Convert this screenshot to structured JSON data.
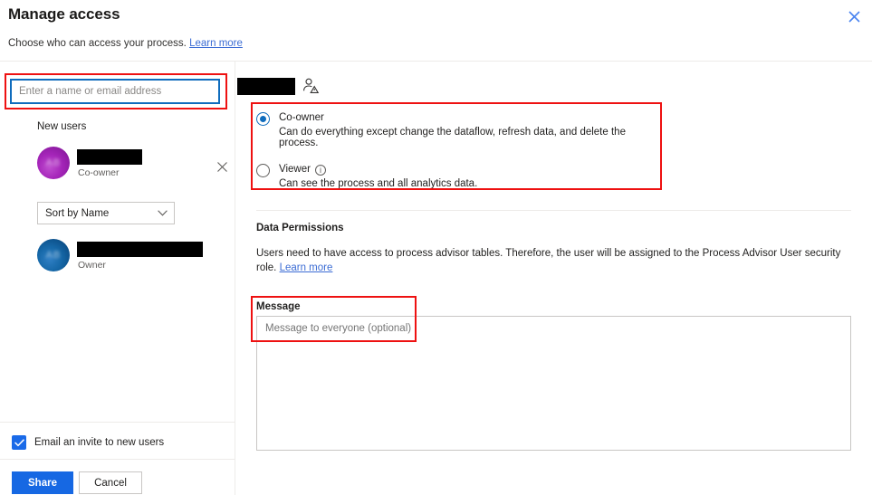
{
  "dialog": {
    "title": "Manage access",
    "subtitle": "Choose who can access your process.",
    "subtitle_link": "Learn more",
    "close_icon": "close-icon"
  },
  "left_panel": {
    "people_input": {
      "placeholder": "Enter a name or email address",
      "value": ""
    },
    "new_users_label": "New users",
    "users": [
      {
        "name": "",
        "role": "Co-owner",
        "avatar_color": "#a626ba",
        "avatar_initials": "AB",
        "removable": true,
        "redacted": true,
        "redact_width": 72
      },
      {
        "name": "",
        "role": "Owner",
        "avatar_color": "#1668a8",
        "avatar_initials": "AB",
        "removable": false,
        "redacted": true,
        "redact_width": 139
      }
    ],
    "sort": {
      "selected": "Sort by Name",
      "options": [
        "Sort by Name"
      ],
      "chevron_icon": "chevron-down-icon"
    },
    "email_invite": {
      "label": "Email an invite to new users",
      "checked": true
    },
    "share_button": "Share",
    "cancel_button": "Cancel"
  },
  "right_panel": {
    "selected_user_name": "",
    "selected_user_icon": "person-warning-icon",
    "roles": [
      {
        "label": "Co-owner",
        "description": "Can do everything except change the dataflow, refresh data, and delete the process.",
        "selected": true,
        "has_info": false
      },
      {
        "label": "Viewer",
        "description": "Can see the process and all analytics data.",
        "selected": false,
        "has_info": true,
        "info_icon": "info-icon"
      }
    ],
    "data_permissions": {
      "title": "Data Permissions",
      "body": "Users need to have access to process advisor tables. Therefore, the user will be assigned to the Process Advisor User security role.",
      "link": "Learn more"
    },
    "message": {
      "label": "Message",
      "placeholder": "Message to everyone (optional)",
      "value": ""
    }
  },
  "annotations": {
    "color": "#ee1111",
    "boxes": [
      "people-input",
      "role-radio-group",
      "message-field"
    ]
  },
  "colors": {
    "accent": "#1668e3",
    "focus_border": "#0f6cbd",
    "link": "#3b6cd4",
    "annotation": "#ee1111",
    "divider": "#edebe9"
  }
}
